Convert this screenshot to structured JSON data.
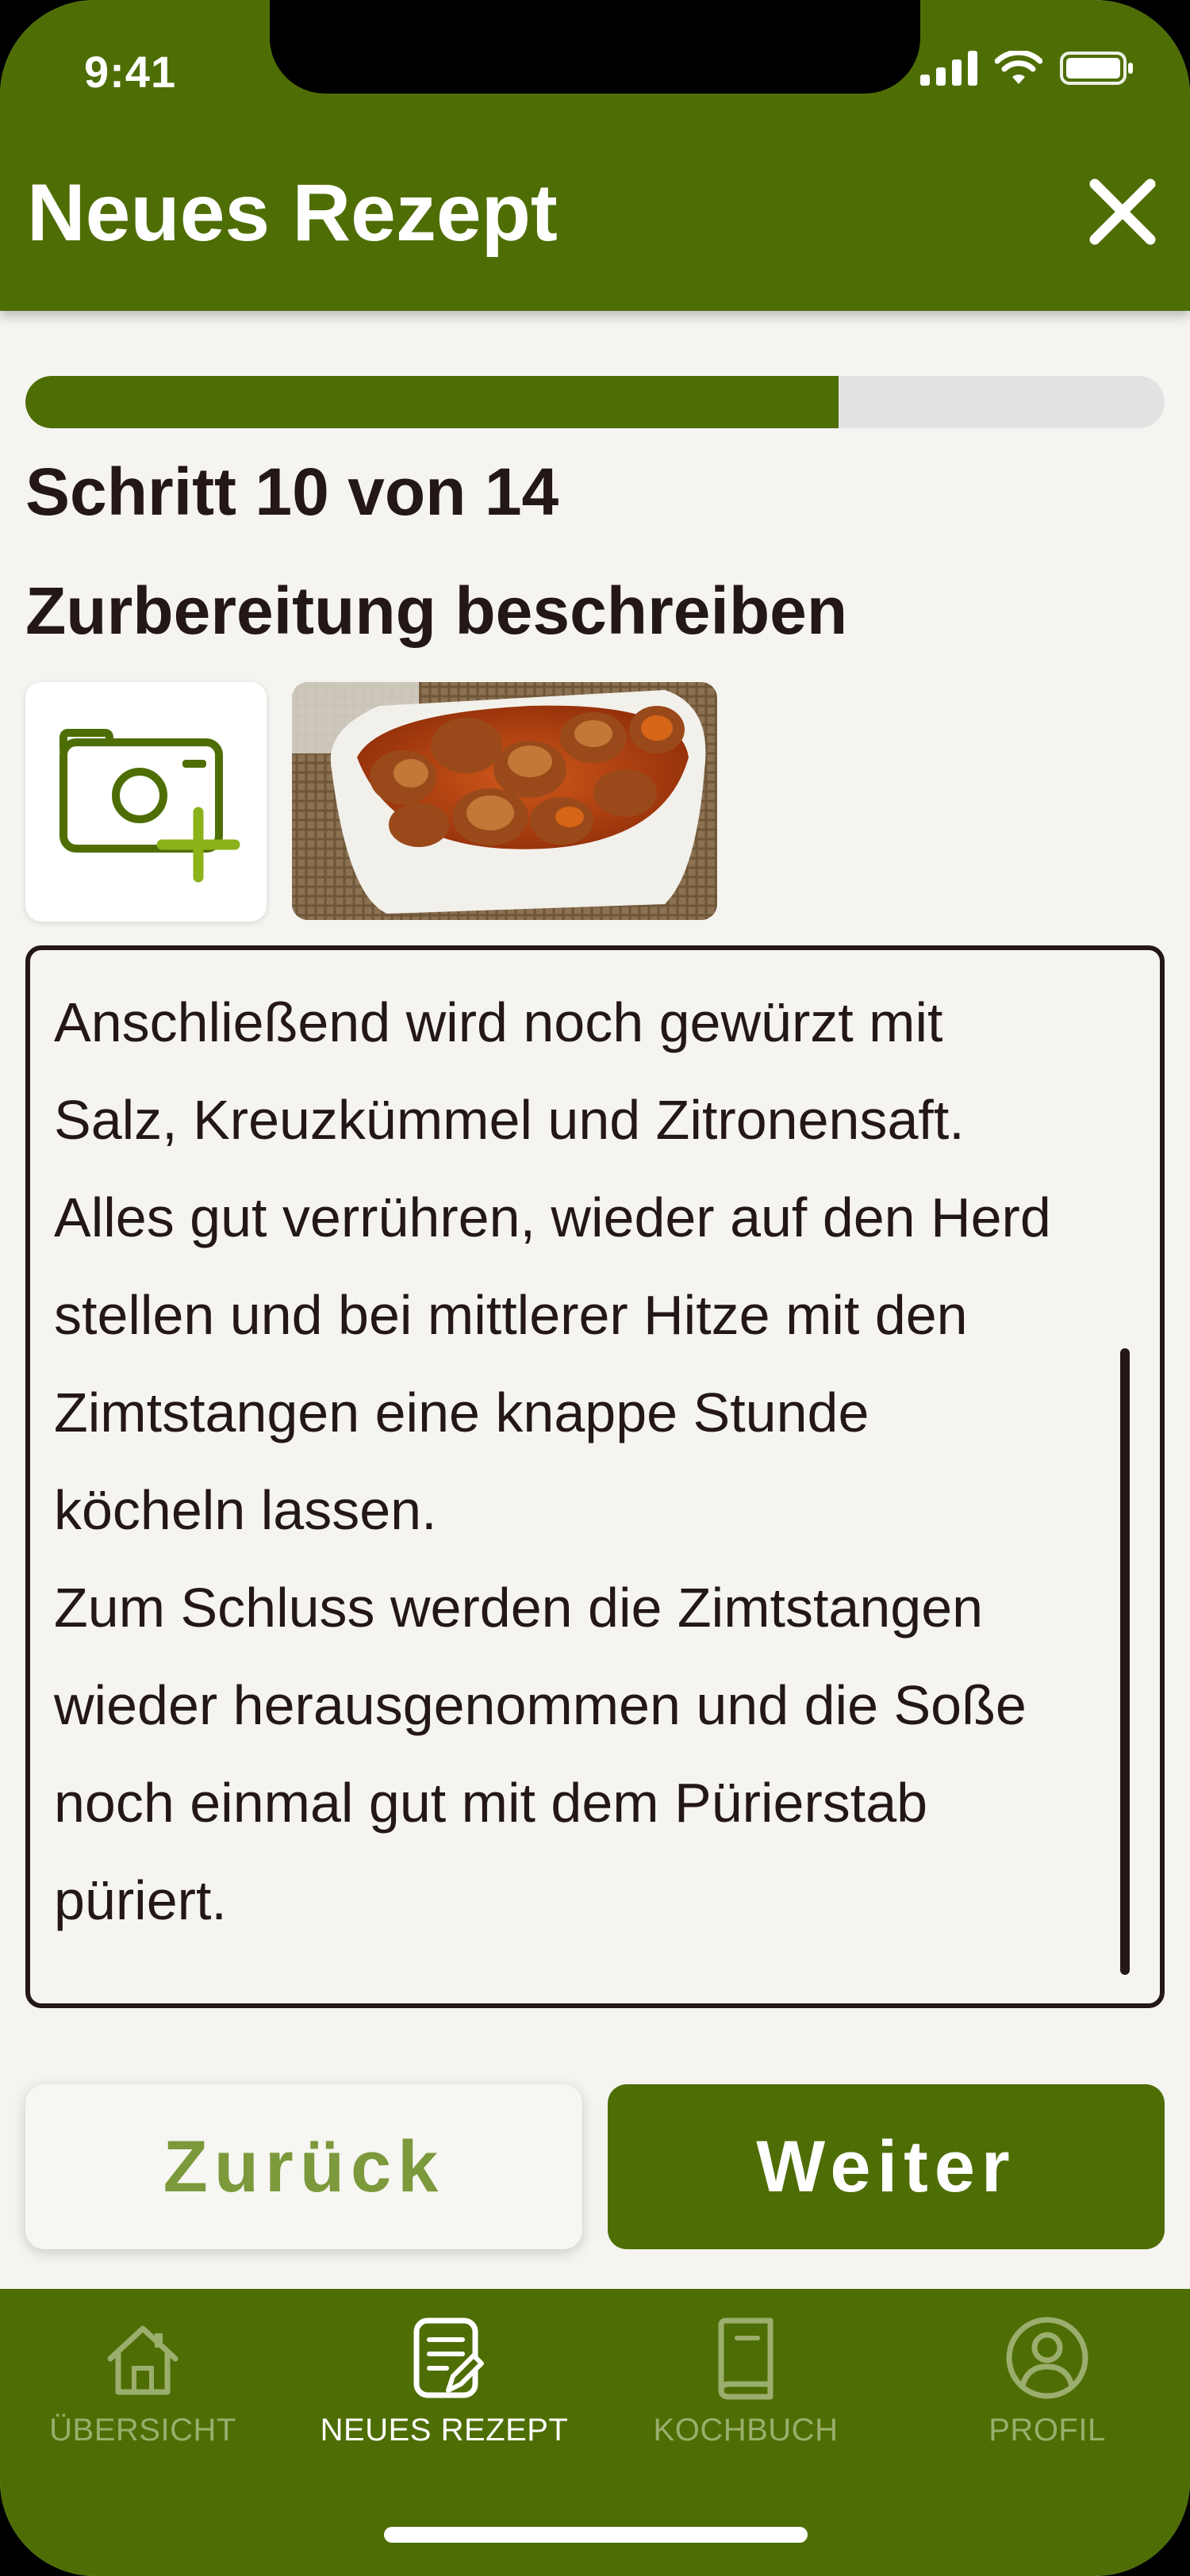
{
  "status_bar": {
    "time": "9:41"
  },
  "header": {
    "title": "Neues Rezept"
  },
  "progress": {
    "current": 10,
    "total": 14,
    "fraction": 0.714,
    "label": "Schritt 10 von 14"
  },
  "section": {
    "title": "Zurbereitung beschreiben"
  },
  "photos": {
    "add_icon": "add-photo-icon",
    "thumbnail": "currywurst-photo"
  },
  "description": {
    "text": "Anschließend wird noch gewürzt mit\nSalz, Kreuzkümmel und Zitronensaft.\nAlles gut verrühren, wieder auf den Herd\nstellen und bei mittlerer Hitze mit den\nZimtstangen eine knappe Stunde\nköcheln lassen.\nZum Schluss werden die Zimtstangen\nwieder herausgenommen und die Soße\nnoch einmal gut mit dem Pürierstab\npüriert."
  },
  "buttons": {
    "back": "Zurück",
    "next": "Weiter"
  },
  "nav": {
    "items": [
      {
        "label": "ÜBERSICHT",
        "icon": "house-icon",
        "active": false
      },
      {
        "label": "NEUES REZEPT",
        "icon": "new-recipe-icon",
        "active": true
      },
      {
        "label": "KOCHBUCH",
        "icon": "book-icon",
        "active": false
      },
      {
        "label": "PROFIL",
        "icon": "user-icon",
        "active": false
      }
    ]
  },
  "colors": {
    "primary": "#4E6E05",
    "background": "#F5F4F1",
    "text": "#231815",
    "accent_green": "#7C993C"
  }
}
